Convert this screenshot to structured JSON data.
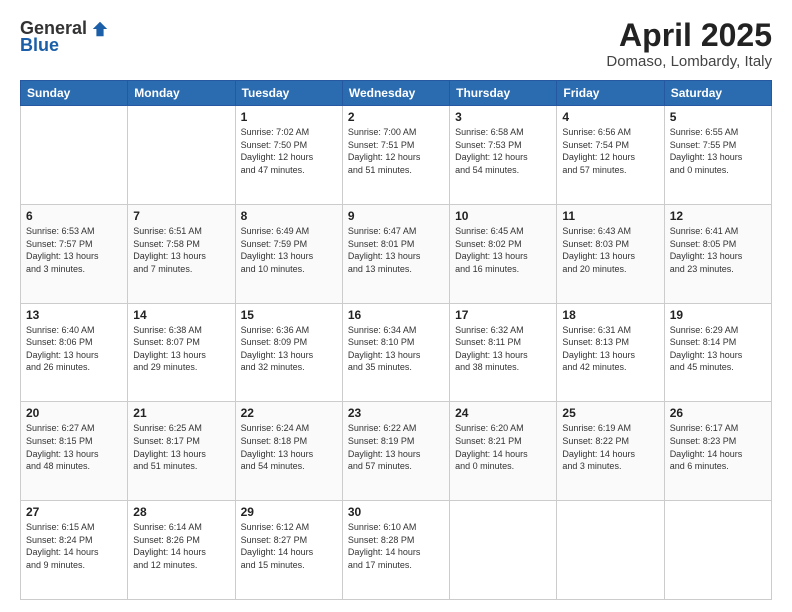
{
  "logo": {
    "general": "General",
    "blue": "Blue"
  },
  "title": {
    "month": "April 2025",
    "location": "Domaso, Lombardy, Italy"
  },
  "days_of_week": [
    "Sunday",
    "Monday",
    "Tuesday",
    "Wednesday",
    "Thursday",
    "Friday",
    "Saturday"
  ],
  "weeks": [
    [
      {
        "day": "",
        "info": ""
      },
      {
        "day": "",
        "info": ""
      },
      {
        "day": "1",
        "info": "Sunrise: 7:02 AM\nSunset: 7:50 PM\nDaylight: 12 hours\nand 47 minutes."
      },
      {
        "day": "2",
        "info": "Sunrise: 7:00 AM\nSunset: 7:51 PM\nDaylight: 12 hours\nand 51 minutes."
      },
      {
        "day": "3",
        "info": "Sunrise: 6:58 AM\nSunset: 7:53 PM\nDaylight: 12 hours\nand 54 minutes."
      },
      {
        "day": "4",
        "info": "Sunrise: 6:56 AM\nSunset: 7:54 PM\nDaylight: 12 hours\nand 57 minutes."
      },
      {
        "day": "5",
        "info": "Sunrise: 6:55 AM\nSunset: 7:55 PM\nDaylight: 13 hours\nand 0 minutes."
      }
    ],
    [
      {
        "day": "6",
        "info": "Sunrise: 6:53 AM\nSunset: 7:57 PM\nDaylight: 13 hours\nand 3 minutes."
      },
      {
        "day": "7",
        "info": "Sunrise: 6:51 AM\nSunset: 7:58 PM\nDaylight: 13 hours\nand 7 minutes."
      },
      {
        "day": "8",
        "info": "Sunrise: 6:49 AM\nSunset: 7:59 PM\nDaylight: 13 hours\nand 10 minutes."
      },
      {
        "day": "9",
        "info": "Sunrise: 6:47 AM\nSunset: 8:01 PM\nDaylight: 13 hours\nand 13 minutes."
      },
      {
        "day": "10",
        "info": "Sunrise: 6:45 AM\nSunset: 8:02 PM\nDaylight: 13 hours\nand 16 minutes."
      },
      {
        "day": "11",
        "info": "Sunrise: 6:43 AM\nSunset: 8:03 PM\nDaylight: 13 hours\nand 20 minutes."
      },
      {
        "day": "12",
        "info": "Sunrise: 6:41 AM\nSunset: 8:05 PM\nDaylight: 13 hours\nand 23 minutes."
      }
    ],
    [
      {
        "day": "13",
        "info": "Sunrise: 6:40 AM\nSunset: 8:06 PM\nDaylight: 13 hours\nand 26 minutes."
      },
      {
        "day": "14",
        "info": "Sunrise: 6:38 AM\nSunset: 8:07 PM\nDaylight: 13 hours\nand 29 minutes."
      },
      {
        "day": "15",
        "info": "Sunrise: 6:36 AM\nSunset: 8:09 PM\nDaylight: 13 hours\nand 32 minutes."
      },
      {
        "day": "16",
        "info": "Sunrise: 6:34 AM\nSunset: 8:10 PM\nDaylight: 13 hours\nand 35 minutes."
      },
      {
        "day": "17",
        "info": "Sunrise: 6:32 AM\nSunset: 8:11 PM\nDaylight: 13 hours\nand 38 minutes."
      },
      {
        "day": "18",
        "info": "Sunrise: 6:31 AM\nSunset: 8:13 PM\nDaylight: 13 hours\nand 42 minutes."
      },
      {
        "day": "19",
        "info": "Sunrise: 6:29 AM\nSunset: 8:14 PM\nDaylight: 13 hours\nand 45 minutes."
      }
    ],
    [
      {
        "day": "20",
        "info": "Sunrise: 6:27 AM\nSunset: 8:15 PM\nDaylight: 13 hours\nand 48 minutes."
      },
      {
        "day": "21",
        "info": "Sunrise: 6:25 AM\nSunset: 8:17 PM\nDaylight: 13 hours\nand 51 minutes."
      },
      {
        "day": "22",
        "info": "Sunrise: 6:24 AM\nSunset: 8:18 PM\nDaylight: 13 hours\nand 54 minutes."
      },
      {
        "day": "23",
        "info": "Sunrise: 6:22 AM\nSunset: 8:19 PM\nDaylight: 13 hours\nand 57 minutes."
      },
      {
        "day": "24",
        "info": "Sunrise: 6:20 AM\nSunset: 8:21 PM\nDaylight: 14 hours\nand 0 minutes."
      },
      {
        "day": "25",
        "info": "Sunrise: 6:19 AM\nSunset: 8:22 PM\nDaylight: 14 hours\nand 3 minutes."
      },
      {
        "day": "26",
        "info": "Sunrise: 6:17 AM\nSunset: 8:23 PM\nDaylight: 14 hours\nand 6 minutes."
      }
    ],
    [
      {
        "day": "27",
        "info": "Sunrise: 6:15 AM\nSunset: 8:24 PM\nDaylight: 14 hours\nand 9 minutes."
      },
      {
        "day": "28",
        "info": "Sunrise: 6:14 AM\nSunset: 8:26 PM\nDaylight: 14 hours\nand 12 minutes."
      },
      {
        "day": "29",
        "info": "Sunrise: 6:12 AM\nSunset: 8:27 PM\nDaylight: 14 hours\nand 15 minutes."
      },
      {
        "day": "30",
        "info": "Sunrise: 6:10 AM\nSunset: 8:28 PM\nDaylight: 14 hours\nand 17 minutes."
      },
      {
        "day": "",
        "info": ""
      },
      {
        "day": "",
        "info": ""
      },
      {
        "day": "",
        "info": ""
      }
    ]
  ]
}
